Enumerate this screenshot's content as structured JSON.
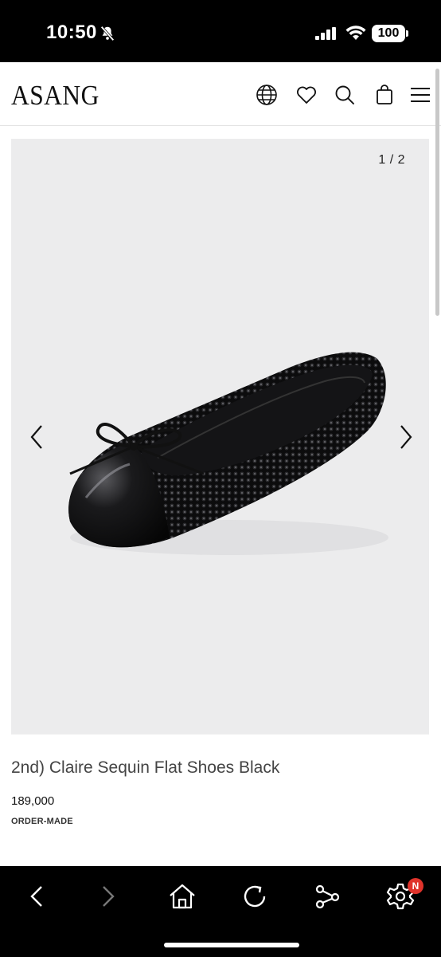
{
  "status_bar": {
    "time": "10:50",
    "battery": "100",
    "icons": [
      "bell-off-icon",
      "signal-icon",
      "wifi-icon",
      "battery-icon"
    ]
  },
  "header": {
    "logo": "ASANG",
    "icons": [
      "globe-icon",
      "heart-icon",
      "search-icon",
      "bag-icon",
      "menu-icon"
    ]
  },
  "gallery": {
    "counter": "1 / 2",
    "prev_icon": "chevron-left-icon",
    "next_icon": "chevron-right-icon",
    "image": "black sequin ballet flat with patent cap toe and bow"
  },
  "product": {
    "title": "2nd) Claire Sequin Flat Shoes Black",
    "price": "189,000",
    "badge": "ORDER-MADE"
  },
  "toolbar": {
    "items": [
      "back-icon",
      "forward-icon",
      "home-icon",
      "reload-icon",
      "share-icon",
      "settings-icon"
    ],
    "notification_badge": "N"
  },
  "colors": {
    "background": "#ffffff",
    "gallery_bg": "#ececed",
    "bars": "#000000",
    "badge_red": "#e0332b"
  }
}
